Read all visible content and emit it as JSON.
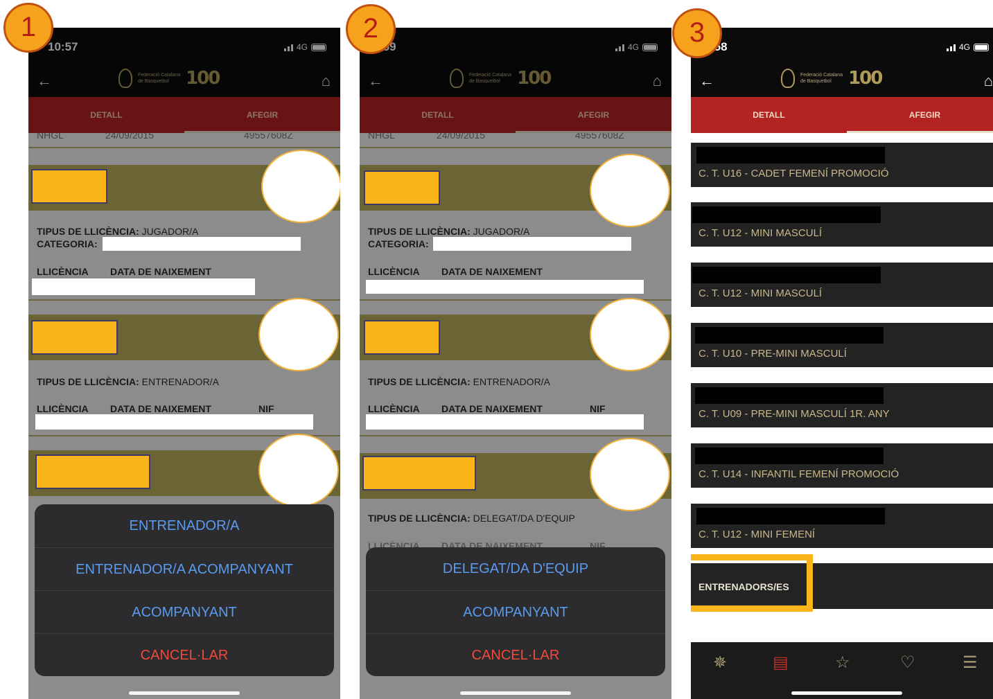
{
  "badges": [
    "1",
    "2",
    "3"
  ],
  "status": {
    "t1": "10:57",
    "t2": ":59",
    "t3": ":58",
    "net": "4G"
  },
  "header": {
    "brand_line1": "Federació Catalana",
    "brand_line2": "de Basquetbol",
    "brand_num": "100"
  },
  "tabs": {
    "detall": "DETALL",
    "afegir": "AFEGIR"
  },
  "cutoff": {
    "a": "NHGL",
    "b": "24/09/2015",
    "c": "49557608Z"
  },
  "labels": {
    "tipus": "TIPUS DE LLICÈNCIA:",
    "jugador": " JUGADOR/A",
    "categoria": "CATEGORIA:",
    "llicencia": "LLICÈNCIA",
    "naixement": "DATA DE NAIXEMENT",
    "nif": "NIF",
    "entrenador": " ENTRENADOR/A",
    "delegat": " DELEGAT/DA D'EQUIP"
  },
  "sheet1": [
    "ENTRENADOR/A",
    "ENTRENADOR/A ACOMPANYANT",
    "ACOMPANYANT",
    "CANCEL·LAR"
  ],
  "sheet2": [
    "DELEGAT/DA D'EQUIP",
    "ACOMPANYANT",
    "CANCEL·LAR"
  ],
  "teams": [
    "C. T. U16 - CADET FEMENÍ PROMOCIÓ",
    "C. T. U12 - MINI MASCULÍ",
    "C. T. U12 - MINI MASCULÍ",
    "C. T. U10 - PRE-MINI MASCULÍ",
    "C. T. U09 - PRE-MINI MASCULÍ 1R. ANY",
    "C. T. U14 - INFANTIL FEMENÍ PROMOCIÓ",
    "C. T. U12 - MINI FEMENÍ"
  ],
  "coaches": "ENTRENADORS/ES",
  "colors": {
    "accent": "#f9b51a",
    "tab_red": "#b32323",
    "olive": "#6b6535",
    "ios_blue": "#5a9bef",
    "ios_red": "#ef4a3c"
  }
}
